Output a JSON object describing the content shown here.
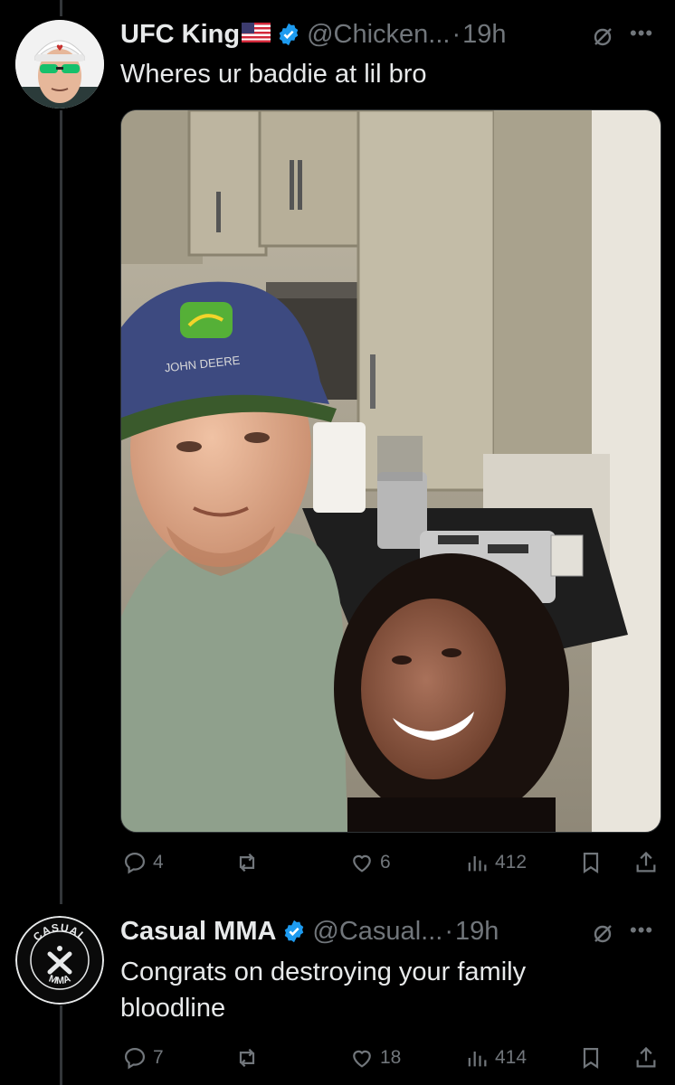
{
  "tweets": [
    {
      "name": "UFC King",
      "handle": "@Chicken...",
      "separator": "·",
      "time": "19h",
      "text": "Wheres ur baddie at lil bro",
      "has_flag": true,
      "has_media": true,
      "media_subject": "selfie-photo",
      "actions": {
        "replies": "4",
        "retweets": "",
        "likes": "6",
        "views": "412"
      }
    },
    {
      "name": "Casual MMA",
      "handle": "@Casual...",
      "separator": "·",
      "time": "19h",
      "text": "Congrats on destroying your family bloodline",
      "has_media": false,
      "avatar_ring_text_top": "CASUAL",
      "avatar_ring_text_bottom": "MMA",
      "actions": {
        "replies": "7",
        "retweets": "",
        "likes": "18",
        "views": "414"
      }
    }
  ],
  "photo_cap_text": "JOHN DEERE",
  "colors": {
    "background": "#000000",
    "text_primary": "#e7e9ea",
    "text_secondary": "#71767b",
    "verified_blue": "#1d9bf0",
    "thread_line": "#333639"
  },
  "icons": [
    "reply-icon",
    "retweet-icon",
    "like-icon",
    "views-icon",
    "bookmark-icon",
    "share-icon",
    "grok-icon",
    "more-icon",
    "verified-icon",
    "us-flag-icon"
  ]
}
